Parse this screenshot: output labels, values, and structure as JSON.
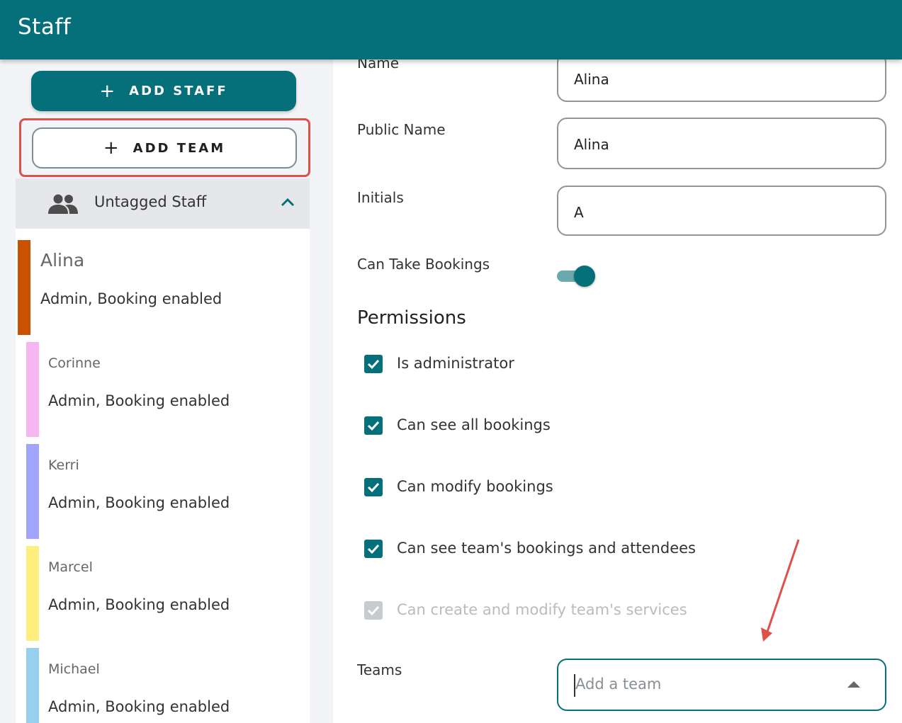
{
  "appbar": {
    "title": "Staff"
  },
  "sidebar": {
    "add_staff": {
      "icon": "+",
      "label": "ADD STAFF"
    },
    "add_team": {
      "icon": "+",
      "label": "ADD TEAM"
    },
    "group": {
      "label": "Untagged Staff",
      "icon": "people-icon",
      "expand_icon": "chevron-up-icon"
    },
    "staff": [
      {
        "name": "Alina",
        "meta": "Admin, Booking enabled",
        "color": "#c85200",
        "selected": true
      },
      {
        "name": "Corinne",
        "meta": "Admin, Booking enabled",
        "color": "#f5b6f1",
        "selected": false
      },
      {
        "name": "Kerri",
        "meta": "Admin, Booking enabled",
        "color": "#a0a4fb",
        "selected": false
      },
      {
        "name": "Marcel",
        "meta": "Admin, Booking enabled",
        "color": "#fdee7e",
        "selected": false
      },
      {
        "name": "Michael",
        "meta": "Admin, Booking enabled",
        "color": "#96d0ec",
        "selected": false
      }
    ]
  },
  "form": {
    "name_label": "Name",
    "name_value": "Alina",
    "public_name_label": "Public Name",
    "public_name_value": "Alina",
    "initials_label": "Initials",
    "initials_value": "A",
    "bookings_label": "Can Take Bookings",
    "bookings_on": true,
    "permissions_title": "Permissions",
    "permissions": [
      {
        "label": "Is administrator",
        "checked": true,
        "disabled": false
      },
      {
        "label": "Can see all bookings",
        "checked": true,
        "disabled": false
      },
      {
        "label": "Can modify bookings",
        "checked": true,
        "disabled": false
      },
      {
        "label": "Can see team's bookings and attendees",
        "checked": true,
        "disabled": false
      },
      {
        "label": "Can create and modify team's services",
        "checked": true,
        "disabled": true
      }
    ],
    "teams_label": "Teams",
    "teams_placeholder": "Add a team"
  },
  "colors": {
    "primary": "#06707a",
    "highlight": "#e0504a"
  }
}
